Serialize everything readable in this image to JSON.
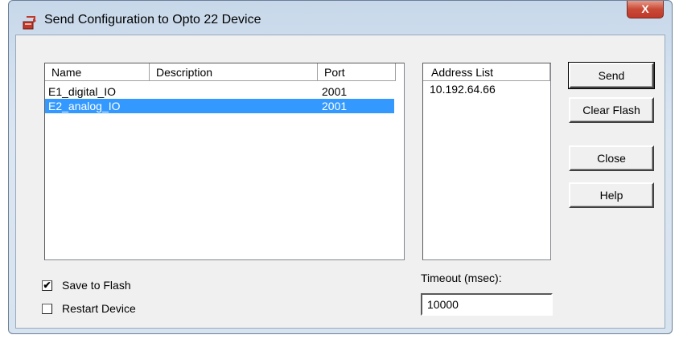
{
  "window": {
    "title": "Send Configuration to Opto 22 Device",
    "close_label": "X"
  },
  "device_list": {
    "columns": [
      "Name",
      "Description",
      "Port"
    ],
    "rows": [
      {
        "name": "E1_digital_IO",
        "description": "",
        "port": "2001",
        "selected": false
      },
      {
        "name": "E2_analog_IO",
        "description": "",
        "port": "2001",
        "selected": true
      }
    ]
  },
  "address_list": {
    "header": "Address List",
    "items": [
      "10.192.64.66"
    ]
  },
  "buttons": {
    "send": "Send",
    "clear_flash": "Clear Flash",
    "close": "Close",
    "help": "Help"
  },
  "options": {
    "save_to_flash": {
      "label": "Save to Flash",
      "checked": true
    },
    "restart_device": {
      "label": "Restart Device",
      "checked": false
    }
  },
  "timeout": {
    "label": "Timeout (msec):",
    "value": "10000"
  },
  "icons": {
    "app": "send-device-icon",
    "check": "✔"
  },
  "colors": {
    "selection": "#3399ff",
    "close_button": "#c84a36"
  }
}
